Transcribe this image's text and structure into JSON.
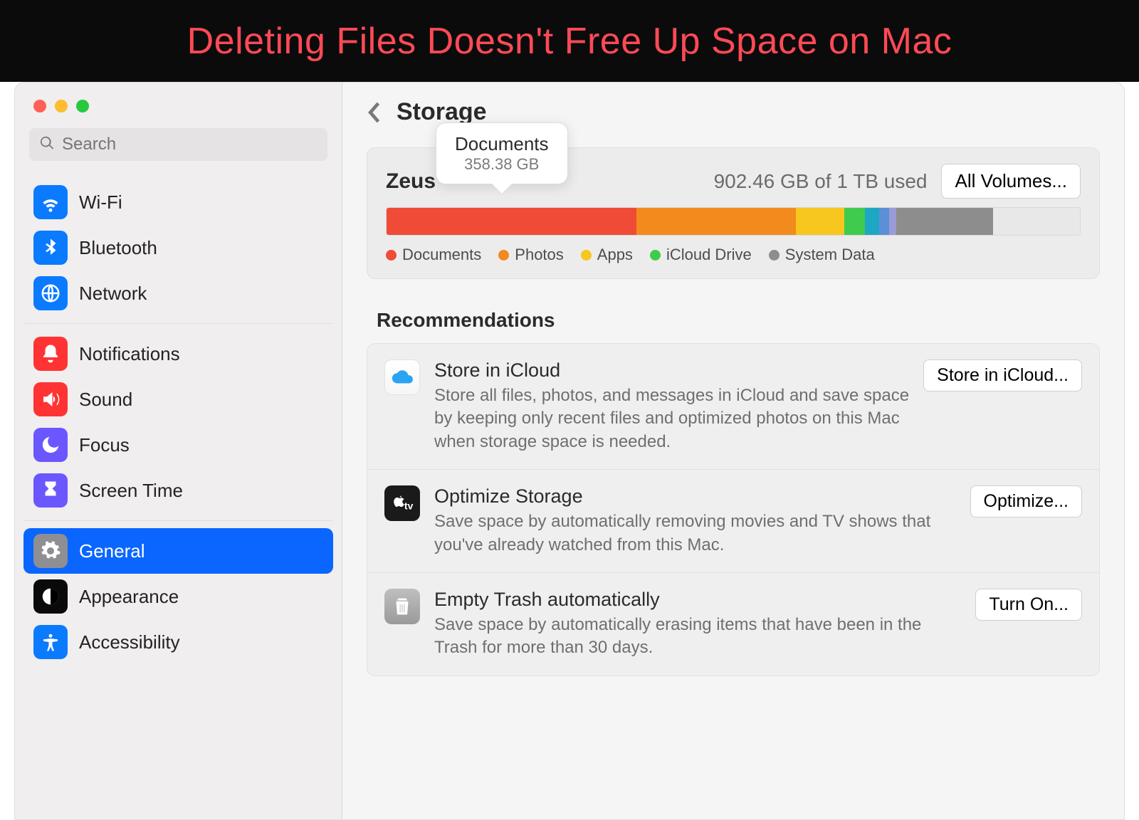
{
  "banner": {
    "title": "Deleting Files Doesn't Free Up Space on Mac"
  },
  "sidebar": {
    "search_placeholder": "Search",
    "groups": [
      {
        "items": [
          {
            "id": "wifi",
            "label": "Wi-Fi"
          },
          {
            "id": "bluetooth",
            "label": "Bluetooth"
          },
          {
            "id": "network",
            "label": "Network"
          }
        ]
      },
      {
        "items": [
          {
            "id": "notifications",
            "label": "Notifications"
          },
          {
            "id": "sound",
            "label": "Sound"
          },
          {
            "id": "focus",
            "label": "Focus"
          },
          {
            "id": "screentime",
            "label": "Screen Time"
          }
        ]
      },
      {
        "items": [
          {
            "id": "general",
            "label": "General",
            "selected": true
          },
          {
            "id": "appearance",
            "label": "Appearance"
          },
          {
            "id": "accessibility",
            "label": "Accessibility"
          }
        ]
      }
    ]
  },
  "main": {
    "title": "Storage",
    "volume": {
      "name": "Zeus",
      "usage_text": "902.46 GB of 1 TB used",
      "all_volumes_label": "All Volumes...",
      "tooltip": {
        "title": "Documents",
        "subtitle": "358.38 GB"
      },
      "segments": [
        {
          "label": "Documents",
          "color": "#f04b36",
          "width": 36
        },
        {
          "label": "Photos",
          "color": "#f28a1e",
          "width": 23
        },
        {
          "label": "Apps",
          "color": "#f7c61f",
          "width": 7
        },
        {
          "label": "iCloud Drive",
          "color": "#3fcb4e",
          "width": 3
        },
        {
          "label": "",
          "color": "#1ea7c4",
          "width": 2
        },
        {
          "label": "",
          "color": "#5b8fd6",
          "width": 1.5
        },
        {
          "label": "",
          "color": "#9b9bd8",
          "width": 1
        },
        {
          "label": "System Data",
          "color": "#8d8d8d",
          "width": 14
        },
        {
          "label": "Free",
          "color": "#e8e8e8",
          "width": 12.5
        }
      ],
      "legend": [
        {
          "label": "Documents",
          "color": "#f04b36"
        },
        {
          "label": "Photos",
          "color": "#f28a1e"
        },
        {
          "label": "Apps",
          "color": "#f7c61f"
        },
        {
          "label": "iCloud Drive",
          "color": "#3fcb4e"
        },
        {
          "label": "System Data",
          "color": "#8d8d8d"
        }
      ]
    },
    "recommendations_heading": "Recommendations",
    "recommendations": [
      {
        "id": "icloud",
        "title": "Store in iCloud",
        "desc": "Store all files, photos, and messages in iCloud and save space by keeping only recent files and optimized photos on this Mac when storage space is needed.",
        "button": "Store in iCloud..."
      },
      {
        "id": "optimize",
        "title": "Optimize Storage",
        "desc": "Save space by automatically removing movies and TV shows that you've already watched from this Mac.",
        "button": "Optimize..."
      },
      {
        "id": "trash",
        "title": "Empty Trash automatically",
        "desc": "Save space by automatically erasing items that have been in the Trash for more than 30 days.",
        "button": "Turn On..."
      }
    ]
  }
}
